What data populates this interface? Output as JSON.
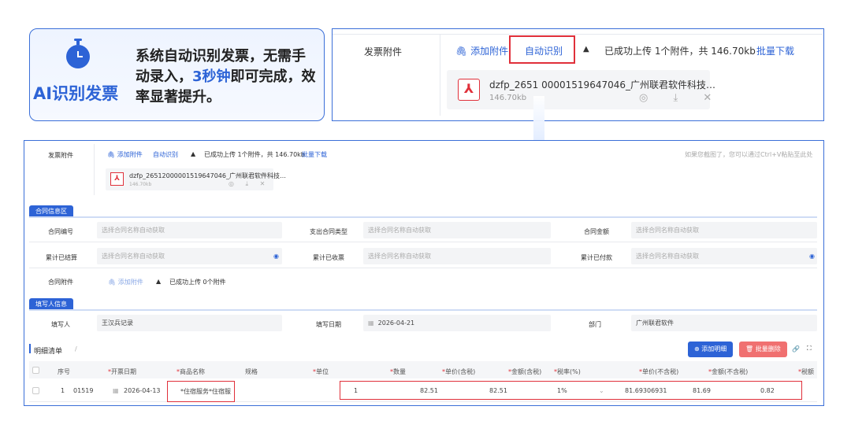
{
  "callout": {
    "title": "AI识别发票",
    "desc_part1": "系统自动识别发票，无需手动录入，",
    "desc_highlight": "3秒钟",
    "desc_part2": "即可完成，效率显著提升。",
    "icon": "stopwatch-icon"
  },
  "zoom": {
    "label": "发票附件",
    "add_attachment": "添加附件",
    "auto_recognize": "自动识别",
    "status": "已成功上传 1个附件，共 146.70kb",
    "batch_download": "批量下载",
    "file_name": "dzfp_26512000001519647046_广州联君软件科技…",
    "file_name_display": "dzfp_2651    00001519647046_广州联君软件科技…",
    "file_size": "146.70kb",
    "file_actions": "◎ ⤓ ✕"
  },
  "panel": {
    "attach_label": "发票附件",
    "add_attachment": "添加附件",
    "auto_recognize": "自动识别",
    "status": "已成功上传 1个附件，共 146.70kb",
    "batch_download": "批量下载",
    "paste_hint": "如果您截图了，您可以通过Ctrl+V粘贴至此处",
    "file_name": "dzfp_26512000001519647046_广州联君软件科技…",
    "file_size": "146.70kb",
    "file_actions": "◎ ⤓ ✕",
    "contract_section": "合同信息区",
    "contract_no_label": "合同编号",
    "contract_no_ph": "选择合同名称自动获取",
    "expense_type_label": "支出合同类型",
    "expense_type_ph": "选择合同名称自动获取",
    "amount_label": "合同金额",
    "amount_ph": "选择合同名称自动获取",
    "settled_label": "累计已结算",
    "settled_ph": "选择合同名称自动获取",
    "received_label": "累计已收票",
    "received_ph": "选择合同名称自动获取",
    "paid_label": "累计已付款",
    "paid_ph": "选择合同名称自动获取",
    "contract_attach_label": "合同附件",
    "contract_attach_add": "添加附件",
    "contract_attach_status": "已成功上传 0个附件",
    "filler_section": "填写人信息",
    "filler_label": "填写人",
    "filler_value": "王汉兵记录",
    "date_label": "填写日期",
    "date_value": "2026-04-21",
    "dept_label": "部门",
    "dept_value": "广州联君软件",
    "detail_title": "明细清单",
    "detail_slash": "/",
    "add_detail": "添加明细",
    "batch_delete": "批量删除",
    "columns": [
      "序号",
      "开票日期",
      "商品名称",
      "规格",
      "单位",
      "数量",
      "单价(含税)",
      "金额(含税)",
      "税率(%)",
      "单价(不含税)",
      "金额(不含税)",
      "税额"
    ],
    "required": [
      false,
      true,
      true,
      false,
      true,
      true,
      true,
      true,
      true,
      true,
      true,
      true
    ],
    "row": {
      "index": "1",
      "invoice_no": "01519",
      "date": "2026-04-13",
      "item": "*住宿服务*住宿服",
      "qty": "1",
      "unit_price_tax": "82.51",
      "amount_tax": "82.51",
      "tax_rate": "1%",
      "unit_price_notax": "81.69306931",
      "amount_notax": "81.69",
      "tax": "0.82"
    }
  },
  "colors": {
    "accent": "#2d63d6",
    "danger": "#e0303a",
    "border": "#3b6fd8"
  }
}
